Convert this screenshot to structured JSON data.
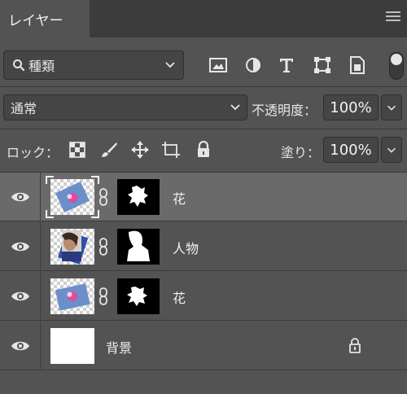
{
  "panel": {
    "tab_label": "レイヤー"
  },
  "filter": {
    "kind_label": "種類"
  },
  "filter_icons": [
    "image-filter-icon",
    "adjustment-filter-icon",
    "type-filter-icon",
    "shape-filter-icon",
    "smart-object-filter-icon"
  ],
  "blend": {
    "mode": "通常",
    "opacity_label": "不透明度：",
    "opacity_value": "100%"
  },
  "lock": {
    "label": "ロック：",
    "fill_label": "塗り：",
    "fill_value": "100%"
  },
  "layers": [
    {
      "name": "花",
      "selected": true
    },
    {
      "name": "人物",
      "selected": false
    },
    {
      "name": "花",
      "selected": false
    },
    {
      "name": "背景",
      "selected": false,
      "locked": true
    }
  ],
  "colors": {
    "panel_bg": "#535353",
    "header_bg": "#3c3c3c",
    "selected_row": "#6a6a6a",
    "field_bg": "#454545"
  }
}
